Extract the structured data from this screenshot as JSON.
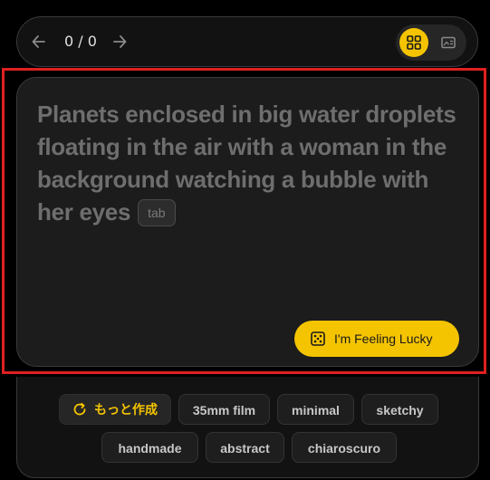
{
  "nav": {
    "counter": "0 / 0",
    "prev_icon": "arrow-left-icon",
    "next_icon": "arrow-right-icon",
    "view_modes": [
      "grid-view-icon",
      "card-view-icon"
    ],
    "active_view": "grid-view-icon"
  },
  "prompt": {
    "text": "Planets enclosed in big water droplets floating in the air with a woman in the background watching a bubble with her eyes",
    "tab_hint": "tab"
  },
  "lucky_button": {
    "label": "I'm Feeling Lucky",
    "icon": "dice-icon"
  },
  "chips": {
    "more_label": "もっと作成",
    "more_icon": "refresh-icon",
    "items": [
      "35mm film",
      "minimal",
      "sketchy",
      "handmade",
      "abstract",
      "chiaroscuro"
    ]
  },
  "colors": {
    "accent": "#f5c400",
    "background": "#000000",
    "card": "#1c1c1c",
    "highlight": "#e02020"
  }
}
